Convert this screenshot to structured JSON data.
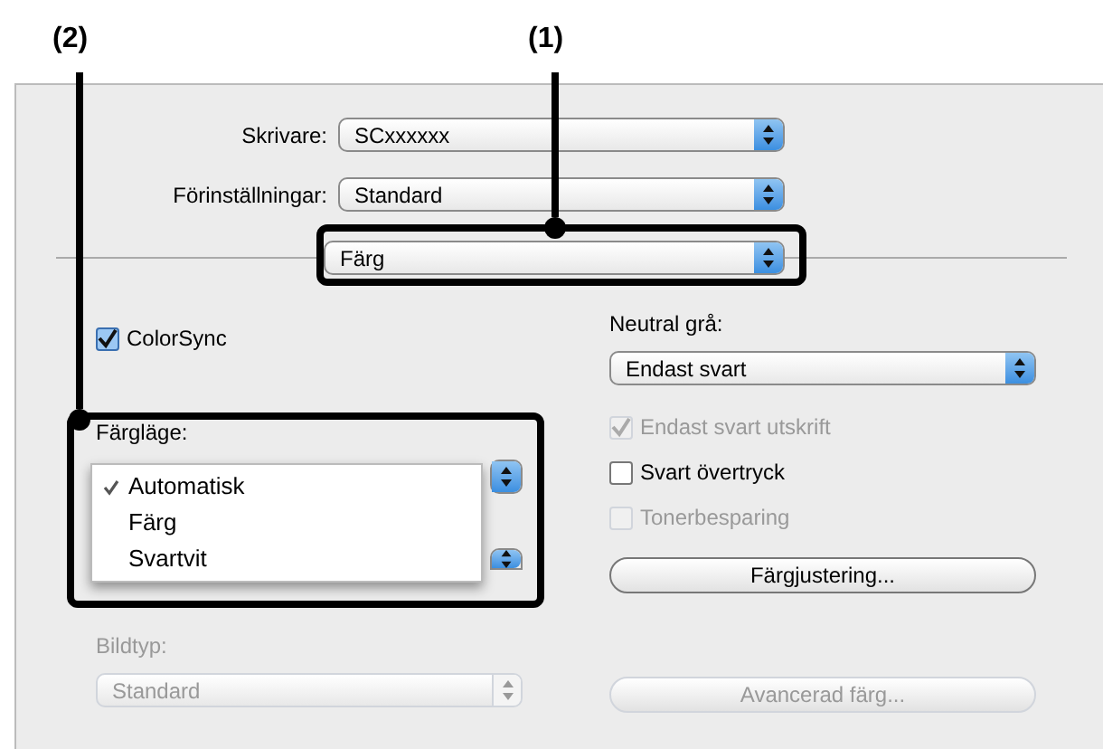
{
  "callouts": [
    {
      "label": "(2)"
    },
    {
      "label": "(1)"
    }
  ],
  "printer": {
    "label": "Skrivare:",
    "value": "SCxxxxxx"
  },
  "presets": {
    "label": "Förinställningar:",
    "value": "Standard"
  },
  "panel_menu": {
    "value": "Färg"
  },
  "colorsync": {
    "label": "ColorSync",
    "checked": true
  },
  "color_mode": {
    "label": "Färgläge:",
    "menu": [
      {
        "label": "Automatisk",
        "selected": true
      },
      {
        "label": "Färg",
        "selected": false
      },
      {
        "label": "Svartvit",
        "selected": false
      }
    ]
  },
  "image_type": {
    "label": "Bildtyp:",
    "value": "Standard",
    "disabled": true
  },
  "neutral_gray": {
    "label": "Neutral grå:",
    "value": "Endast svart"
  },
  "options": [
    {
      "label": "Endast svart utskrift",
      "checked": true,
      "disabled": true
    },
    {
      "label": "Svart övertryck",
      "checked": false,
      "disabled": false
    },
    {
      "label": "Tonerbesparing",
      "checked": false,
      "disabled": true
    }
  ],
  "buttons": [
    {
      "label": "Färgjustering...",
      "disabled": false
    },
    {
      "label": "Avancerad färg...",
      "disabled": true
    }
  ]
}
